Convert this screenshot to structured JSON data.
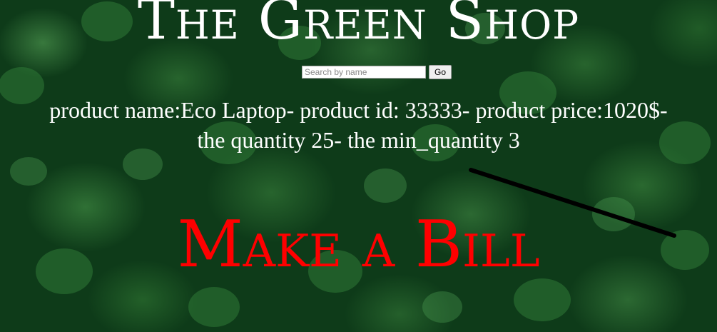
{
  "header": {
    "title": "The Green Shop"
  },
  "search": {
    "placeholder": "Search by name",
    "value": "",
    "button_label": "Go"
  },
  "product": {
    "text": "product name:Eco Laptop- product id: 33333- product price:1020$- the quantity 25- the min_quantity 3"
  },
  "bill": {
    "label": "Make a Bill"
  },
  "colors": {
    "title": "#ffffff",
    "bill": "#ff0000",
    "background": "#0e3b19"
  }
}
